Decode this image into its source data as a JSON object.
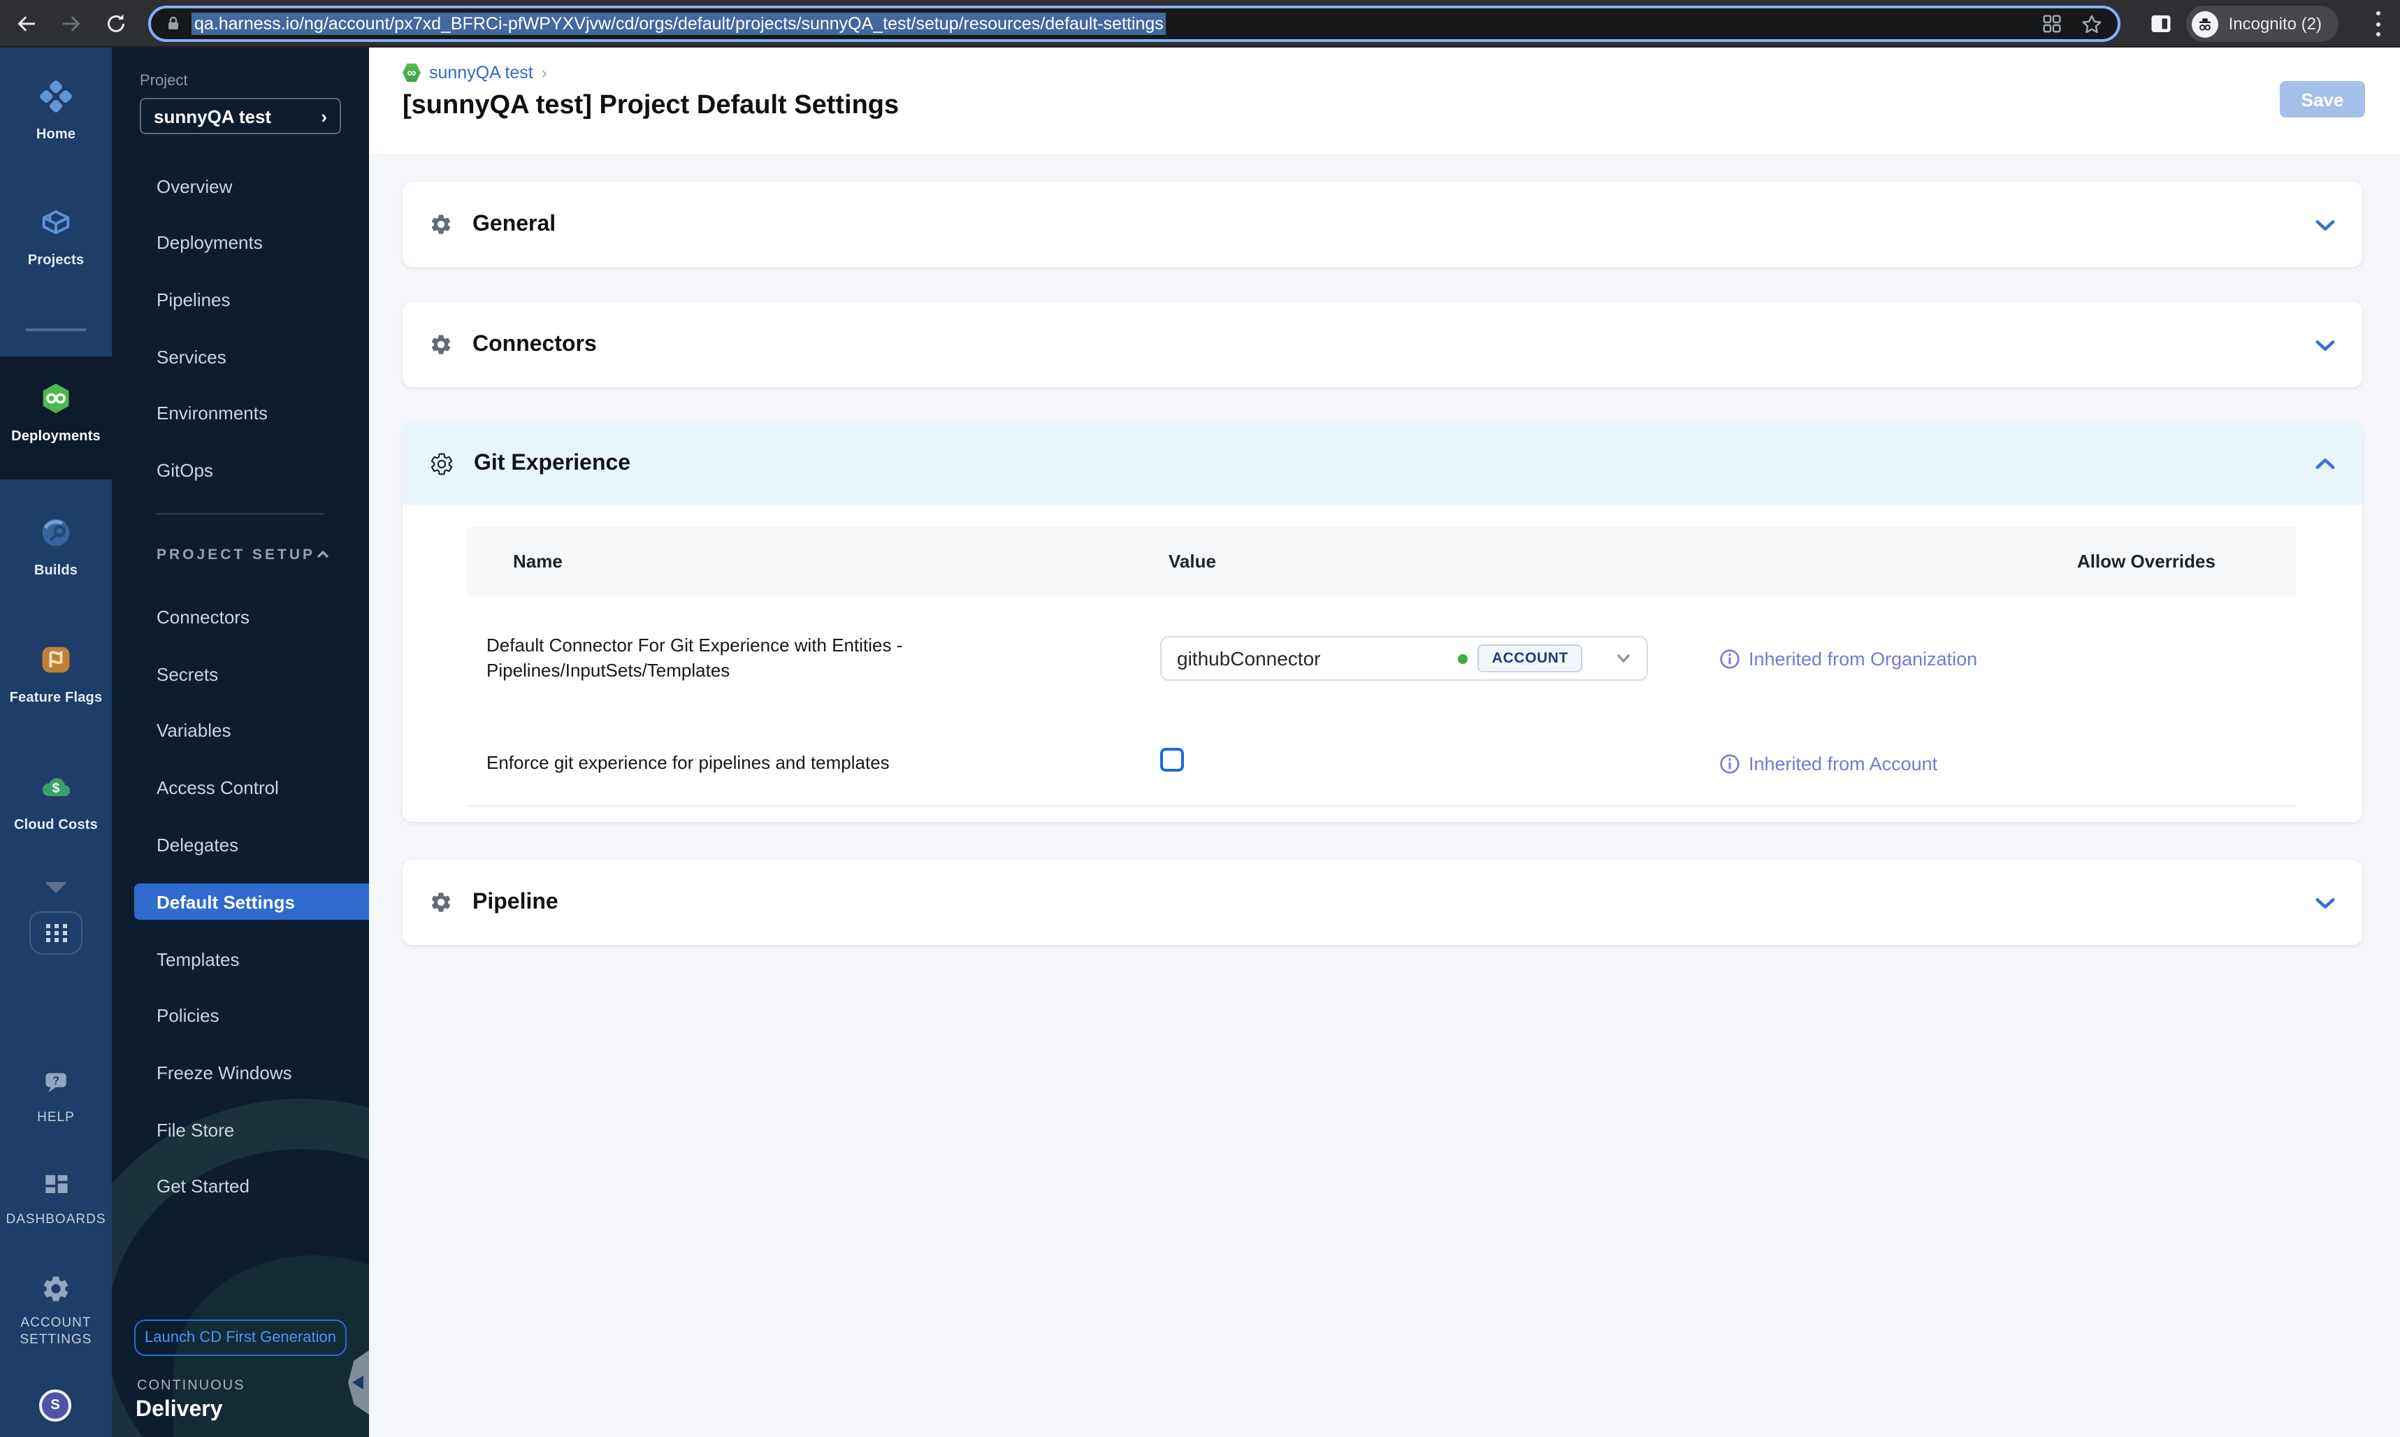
{
  "browser": {
    "url": "qa.harness.io/ng/account/px7xd_BFRCi-pfWPYXVjvw/cd/orgs/default/projects/sunnyQA_test/setup/resources/default-settings",
    "incognito_label": "Incognito (2)"
  },
  "module_nav": {
    "items": [
      {
        "label": "Home"
      },
      {
        "label": "Projects"
      },
      {
        "label": "Deployments",
        "active": true
      },
      {
        "label": "Builds"
      },
      {
        "label": "Feature Flags"
      },
      {
        "label": "Cloud Costs"
      }
    ],
    "help_label": "HELP",
    "dashboards_label": "DASHBOARDS",
    "account_settings_line1": "ACCOUNT",
    "account_settings_line2": "SETTINGS",
    "avatar_initial": "S"
  },
  "project_nav": {
    "project_label": "Project",
    "project_name": "sunnyQA test",
    "items": [
      "Overview",
      "Deployments",
      "Pipelines",
      "Services",
      "Environments",
      "GitOps"
    ],
    "setup_label": "PROJECT SETUP",
    "setup_items": [
      "Connectors",
      "Secrets",
      "Variables",
      "Access Control",
      "Delegates",
      "Default Settings",
      "Templates",
      "Policies",
      "Freeze Windows",
      "File Store",
      "Get Started"
    ],
    "active_setup_item": "Default Settings",
    "launch_button_label": "Launch CD First Generation",
    "footer_kicker": "CONTINUOUS",
    "footer_title": "Delivery"
  },
  "page": {
    "breadcrumb": "sunnyQA test",
    "title": "[sunnyQA test] Project Default Settings",
    "save_label": "Save",
    "sections": {
      "general": "General",
      "connectors": "Connectors",
      "git_experience": "Git Experience",
      "pipeline": "Pipeline"
    },
    "git_table": {
      "headers": {
        "name": "Name",
        "value": "Value",
        "allow_overrides": "Allow Overrides"
      },
      "rows": [
        {
          "name": "Default Connector For Git Experience with Entities - Pipelines/InputSets/Templates",
          "value": "githubConnector",
          "value_scope": "ACCOUNT",
          "inherited": "Inherited from Organization",
          "checked": false
        },
        {
          "name": "Enforce git experience for pipelines and templates",
          "inherited": "Inherited from Account",
          "checked": false
        }
      ]
    }
  },
  "colors": {
    "accent_blue": "#2f6bcd",
    "inherited_link": "#757bd4",
    "git_header_bg": "#e8f6fb",
    "active_nav_bg": "#2f6bcd",
    "save_disabled_bg": "#a4c0ea",
    "module_sidebar_bg": "#1e3d68",
    "project_sidebar_bg": "#0c1d30",
    "success_green": "#42ab45"
  }
}
